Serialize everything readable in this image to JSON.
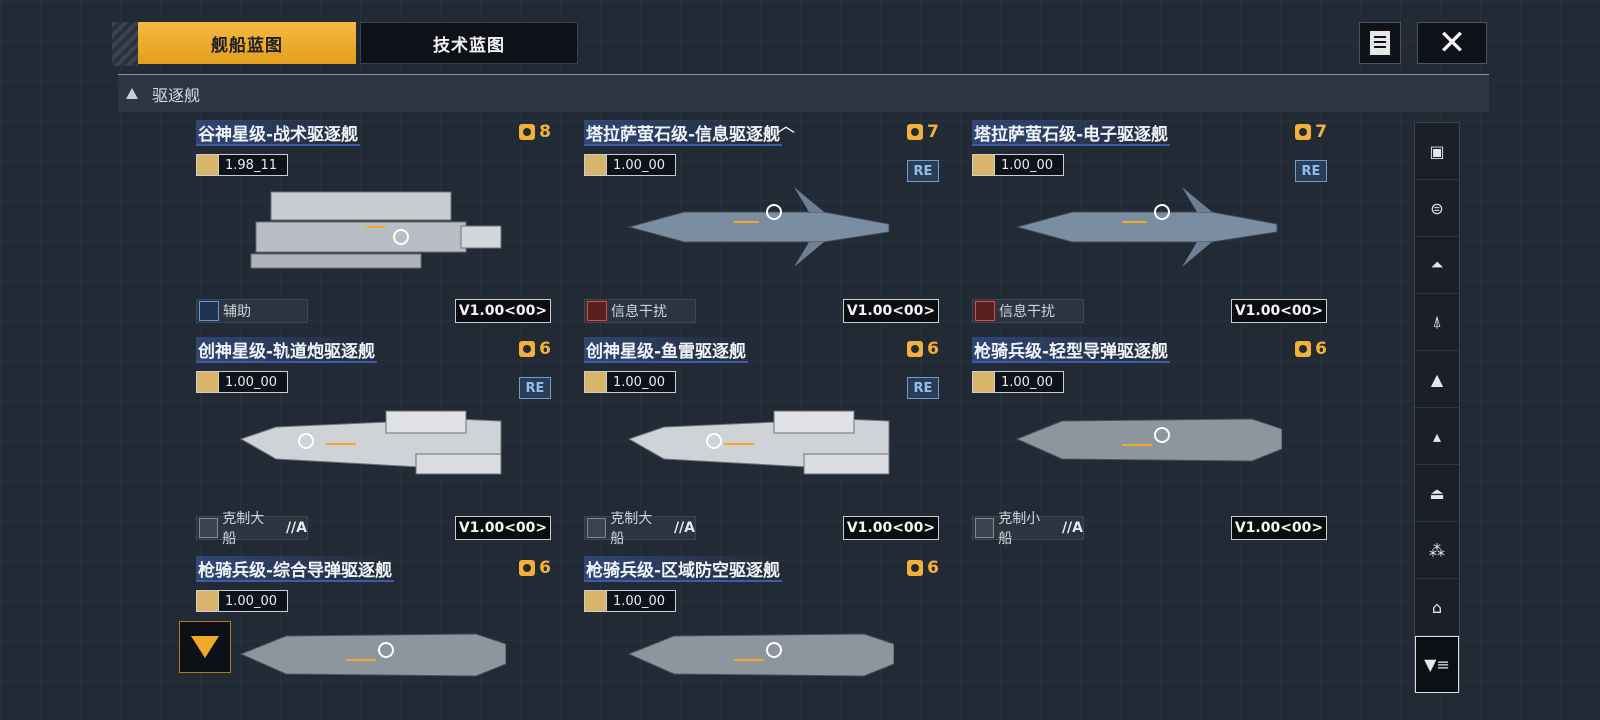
{
  "tabs": {
    "active": "舰船蓝图",
    "inactive": "技术蓝图"
  },
  "close_label": "✕",
  "category": "驱逐舰",
  "ships": [
    {
      "name": "谷神星级-战术驱逐舰",
      "cost": "8",
      "stat": "1.98_11",
      "re": "",
      "role": "辅助",
      "grade": "",
      "version": "V1.00<00>"
    },
    {
      "name": "塔拉萨萤石级-信息驱逐舰",
      "cost": "7",
      "stat": "1.00_00",
      "re": "RE",
      "role": "信息干扰",
      "grade": "",
      "version": "V1.00<00>"
    },
    {
      "name": "塔拉萨萤石级-电子驱逐舰",
      "cost": "7",
      "stat": "1.00_00",
      "re": "RE",
      "role": "信息干扰",
      "grade": "",
      "version": "V1.00<00>"
    },
    {
      "name": "创神星级-轨道炮驱逐舰",
      "cost": "6",
      "stat": "1.00_00",
      "re": "RE",
      "role": "克制大船",
      "grade": "//A",
      "version": "V1.00<00>"
    },
    {
      "name": "创神星级-鱼雷驱逐舰",
      "cost": "6",
      "stat": "1.00_00",
      "re": "RE",
      "role": "克制大船",
      "grade": "//A",
      "version": "V1.00<00>"
    },
    {
      "name": "枪骑兵级-轻型导弹驱逐舰",
      "cost": "6",
      "stat": "1.00_00",
      "re": "",
      "role": "克制小船",
      "grade": "//A",
      "version": "V1.00<00>"
    },
    {
      "name": "枪骑兵级-综合导弹驱逐舰",
      "cost": "6",
      "stat": "1.00_00",
      "re": "",
      "role": "",
      "grade": "",
      "version": ""
    },
    {
      "name": "枪骑兵级-区域防空驱逐舰",
      "cost": "6",
      "stat": "1.00_00",
      "re": "",
      "role": "",
      "grade": "",
      "version": ""
    }
  ],
  "sidebar_icons": [
    "carrier-icon",
    "battlecruiser-icon",
    "cruiser-icon",
    "frigate-icon",
    "destroyer-icon",
    "corvette-icon",
    "aircraft-icon",
    "formation-icon",
    "special-icon",
    "filter-icon"
  ],
  "colors": {
    "accent": "#f5b941",
    "tab_bg": "#0e1117",
    "title_bar": "#3c5ca8",
    "re_badge": "#8cc0f0",
    "role_red": "#e04a3a"
  }
}
